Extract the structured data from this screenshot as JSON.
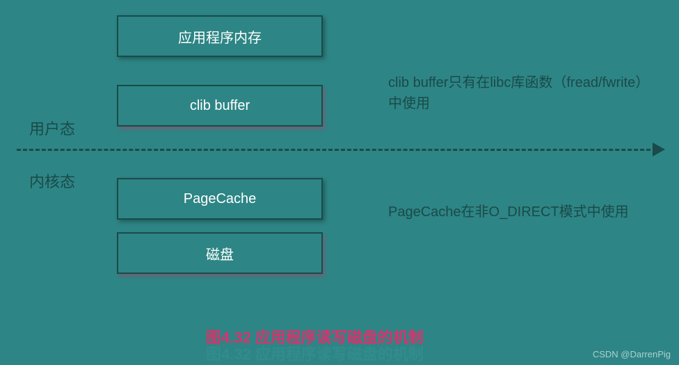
{
  "boxes": {
    "app_memory": "应用程序内存",
    "clib_buffer": "clib buffer",
    "page_cache": "PageCache",
    "disk": "磁盘"
  },
  "labels": {
    "user_space": "用户态",
    "kernel_space": "内核态"
  },
  "notes": {
    "clib": "clib buffer只有在libc库函数（fread/fwrite）中使用",
    "pagecache": "PageCache在非O_DIRECT模式中使用"
  },
  "caption": "图4.32 应用程序读写磁盘的机制",
  "watermark": "CSDN @DarrenPig"
}
